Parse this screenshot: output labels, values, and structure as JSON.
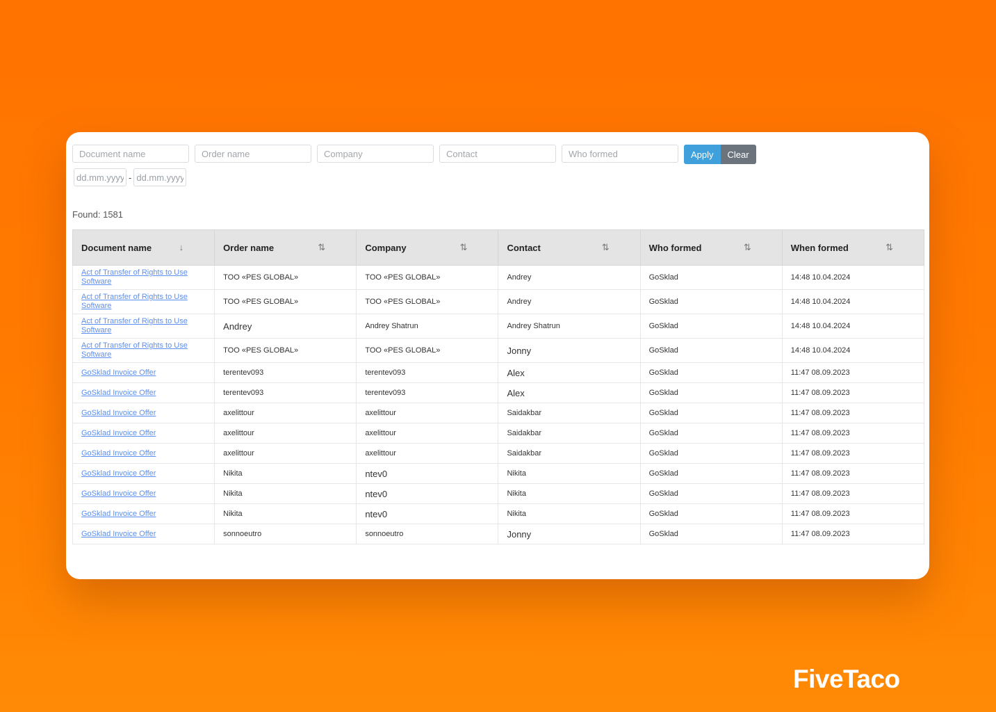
{
  "filters": {
    "document_name": "Document name",
    "order_name": "Order name",
    "company": "Company",
    "contact": "Contact",
    "who_formed": "Who formed",
    "date_from": "dd.mm.yyyy",
    "date_to": "dd.mm.yyyy",
    "date_separator": "-",
    "apply": "Apply",
    "clear": "Clear"
  },
  "found": "Found: 1581",
  "columns": [
    {
      "label": "Document name",
      "sort": "↓"
    },
    {
      "label": "Order name",
      "sort": "⇅"
    },
    {
      "label": "Company",
      "sort": "⇅"
    },
    {
      "label": "Contact",
      "sort": "⇅"
    },
    {
      "label": "Who formed",
      "sort": "⇅"
    },
    {
      "label": "When formed",
      "sort": "⇅"
    }
  ],
  "rows": [
    [
      "Act of Transfer of Rights to Use Software",
      "TOO «PES GLOBAL»",
      "TOO «PES GLOBAL»",
      "Andrey",
      "GoSklad",
      "14:48 10.04.2024"
    ],
    [
      "Act of Transfer of Rights to Use Software",
      "TOO «PES GLOBAL»",
      "TOO «PES GLOBAL»",
      "Andrey",
      "GoSklad",
      "14:48 10.04.2024"
    ],
    [
      "Act of Transfer of Rights to Use Software",
      "Andrey",
      "Andrey Shatrun",
      "Andrey Shatrun",
      "GoSklad",
      "14:48 10.04.2024"
    ],
    [
      "Act of Transfer of Rights to Use Software",
      "TOO «PES GLOBAL»",
      "TOO «PES GLOBAL»",
      "Jonny",
      "GoSklad",
      "14:48 10.04.2024"
    ],
    [
      "GoSklad Invoice Offer",
      "terentev093",
      "terentev093",
      "Alex",
      "GoSklad",
      "11:47 08.09.2023"
    ],
    [
      "GoSklad Invoice Offer",
      "terentev093",
      "terentev093",
      "Alex",
      "GoSklad",
      "11:47 08.09.2023"
    ],
    [
      "GoSklad Invoice Offer",
      "axelittour",
      "axelittour",
      "Saidakbar",
      "GoSklad",
      "11:47 08.09.2023"
    ],
    [
      "GoSklad Invoice Offer",
      "axelittour",
      "axelittour",
      "Saidakbar",
      "GoSklad",
      "11:47 08.09.2023"
    ],
    [
      "GoSklad Invoice Offer",
      "axelittour",
      "axelittour",
      "Saidakbar",
      "GoSklad",
      "11:47 08.09.2023"
    ],
    [
      "GoSklad Invoice Offer",
      "Nikita",
      "ntev0",
      "Nikita",
      "GoSklad",
      "11:47 08.09.2023"
    ],
    [
      "GoSklad Invoice Offer",
      "Nikita",
      "ntev0",
      "Nikita",
      "GoSklad",
      "11:47 08.09.2023"
    ],
    [
      "GoSklad Invoice Offer",
      "Nikita",
      "ntev0",
      "Nikita",
      "GoSklad",
      "11:47 08.09.2023"
    ],
    [
      "GoSklad Invoice Offer",
      "sonnoeutro",
      "sonnoeutro",
      "Jonny",
      "GoSklad",
      "11:47 08.09.2023"
    ]
  ],
  "brand": "FiveTaco"
}
